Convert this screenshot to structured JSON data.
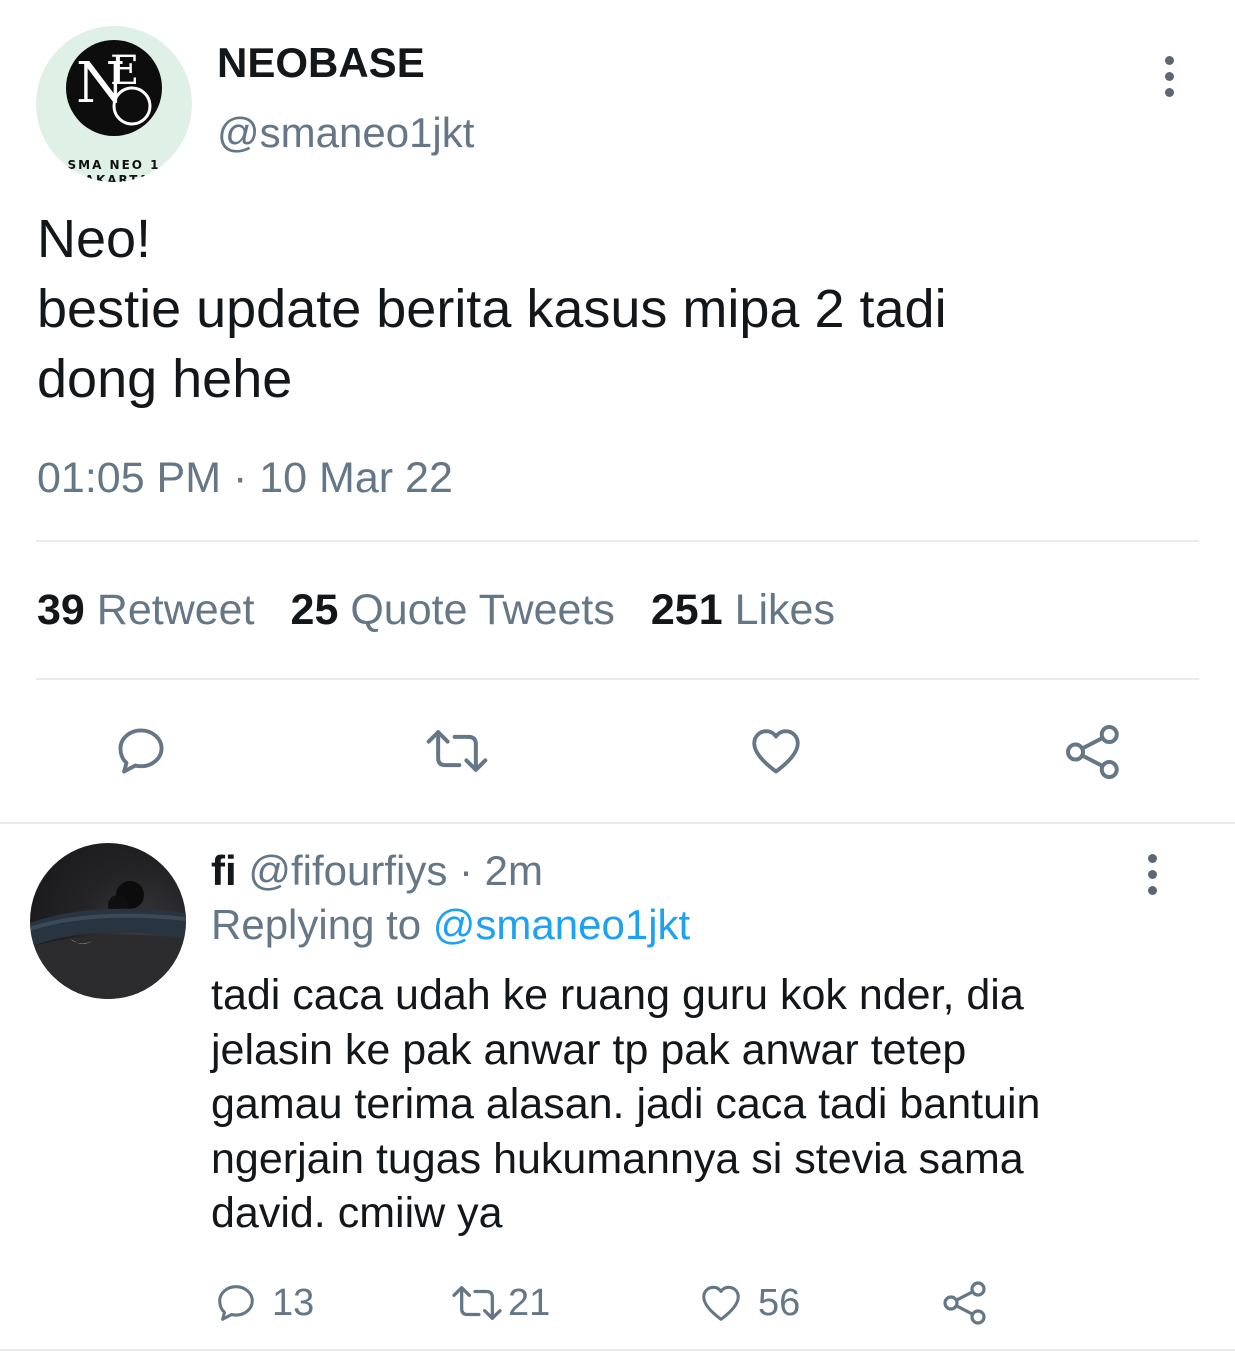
{
  "tweet": {
    "author": {
      "name": "NEOBASE",
      "handle": "@smaneo1jkt",
      "avatar": {
        "logo_letters": "NEO",
        "caption_line1": "SMA NEO 1",
        "caption_line2": "JAKARTA"
      }
    },
    "text_lines": [
      "Neo!",
      "bestie update berita kasus mipa 2 tadi",
      "dong hehe"
    ],
    "timestamp": "01:05 PM · 10 Mar 22",
    "stats": {
      "retweets": {
        "count": "39",
        "label": "Retweet"
      },
      "quotes": {
        "count": "25",
        "label": "Quote Tweets"
      },
      "likes": {
        "count": "251",
        "label": "Likes"
      }
    },
    "actions": [
      "reply-icon",
      "retweet-icon",
      "like-icon",
      "share-icon"
    ]
  },
  "reply": {
    "name": "fi",
    "handle": "@fifourfiys",
    "separator": " · ",
    "time": "2m",
    "replying_prefix": "Replying to ",
    "replying_to": "@smaneo1jkt",
    "text_lines": [
      "tadi caca udah ke ruang guru kok nder, dia",
      "jelasin ke pak anwar tp pak anwar tetep",
      "gamau terima alasan. jadi caca tadi bantuin",
      "ngerjain tugas hukumannya si stevia sama",
      "david. cmiiw ya"
    ],
    "counts": {
      "replies": "13",
      "retweets": "21",
      "likes": "56"
    }
  },
  "colors": {
    "text_primary": "#14171a",
    "text_secondary": "#657786",
    "mention": "#1da1f2",
    "divider": "#e6ecf0"
  }
}
